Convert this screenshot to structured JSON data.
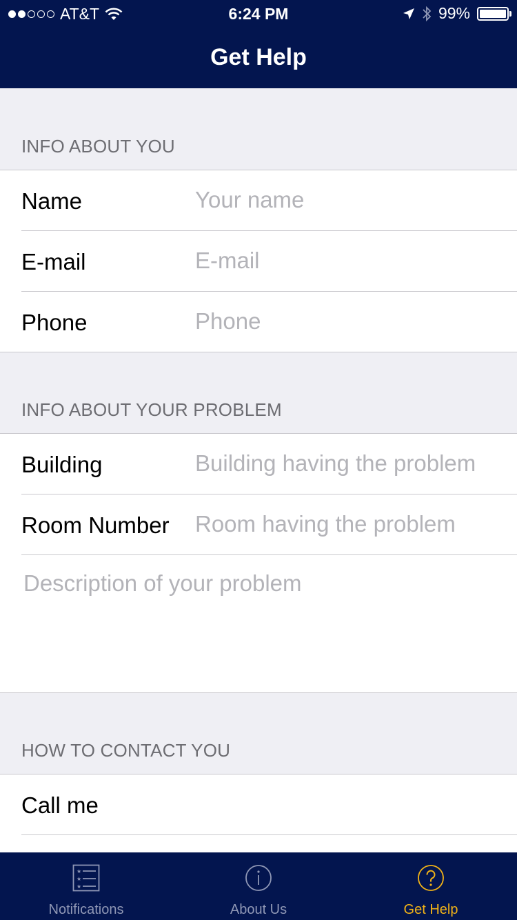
{
  "status_bar": {
    "carrier": "AT&T",
    "time": "6:24 PM",
    "battery": "99%",
    "battery_level": 0.99
  },
  "nav": {
    "title": "Get Help"
  },
  "sections": {
    "about_you": {
      "header": "INFO ABOUT YOU",
      "name": {
        "label": "Name",
        "placeholder": "Your name"
      },
      "email": {
        "label": "E-mail",
        "placeholder": "E-mail"
      },
      "phone": {
        "label": "Phone",
        "placeholder": "Phone"
      }
    },
    "problem": {
      "header": "INFO ABOUT YOUR PROBLEM",
      "building": {
        "label": "Building",
        "placeholder": "Building having the problem"
      },
      "room": {
        "label": "Room Number",
        "placeholder": "Room having the problem"
      },
      "description_placeholder": "Description of your problem"
    },
    "contact": {
      "header": "HOW TO CONTACT YOU",
      "call_me": "Call me"
    }
  },
  "tabs": [
    {
      "label": "Notifications",
      "icon": "list-icon",
      "active": false
    },
    {
      "label": "About Us",
      "icon": "info-icon",
      "active": false
    },
    {
      "label": "Get Help",
      "icon": "question-icon",
      "active": true
    }
  ],
  "colors": {
    "nav_background": "#03154f",
    "tab_active": "#f2b317",
    "tab_inactive": "#8f97b5",
    "section_background": "#efeff4",
    "placeholder": "#b3b3b8"
  }
}
